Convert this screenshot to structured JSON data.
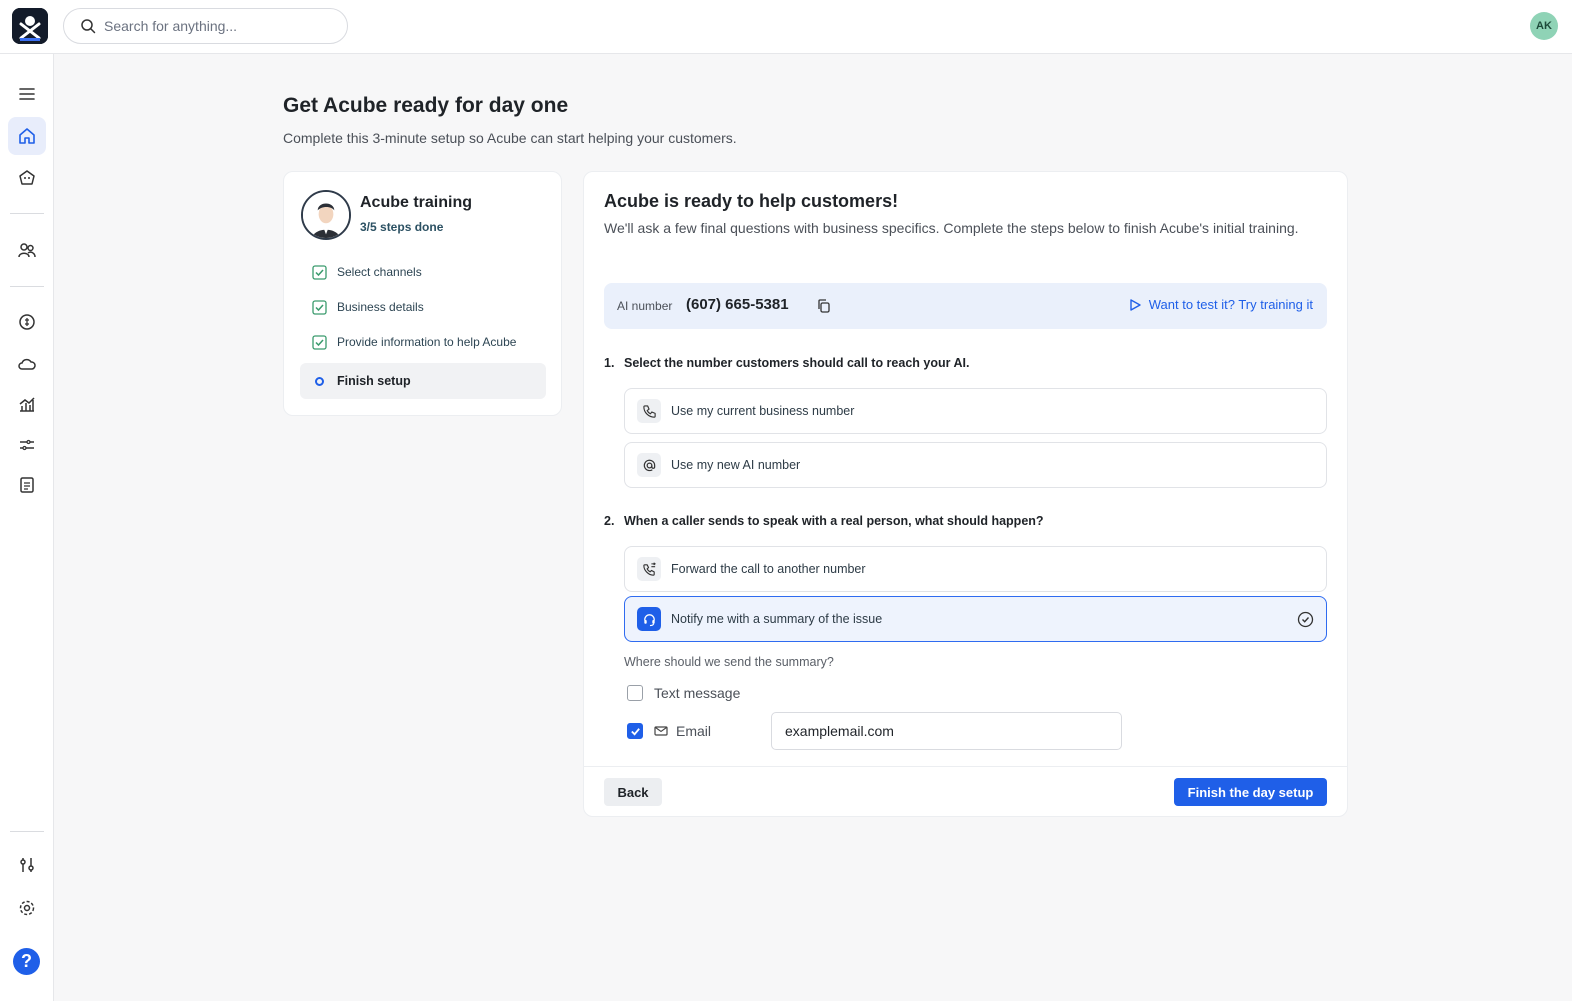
{
  "search": {
    "placeholder": "Search for anything..."
  },
  "user": {
    "initials": "AK"
  },
  "colors": {
    "accent": "#1f5fe8",
    "success": "#3a9b6d"
  },
  "page": {
    "title": "Get Acube ready for day one",
    "subtitle": "Complete this 3-minute setup so Acube can start helping your customers."
  },
  "training": {
    "title": "Acube training",
    "progress": "3/5 steps done",
    "steps": [
      {
        "label": "Select channels",
        "status": "done"
      },
      {
        "label": "Business details",
        "status": "done"
      },
      {
        "label": "Provide information to help Acube",
        "status": "done"
      },
      {
        "label": "Finish setup",
        "status": "current"
      }
    ]
  },
  "main": {
    "title": "Acube is ready to help customers!",
    "description": "We'll ask a few final questions with business specifics. Complete the steps below to finish Acube's initial training.",
    "ai_number_label": "AI number",
    "ai_number": "(607) 665-5381",
    "test_link": "Want to test it? Try training it",
    "q1": {
      "num": "1.",
      "text": "Select the number customers should call to reach your AI.",
      "options": [
        {
          "label": "Use my current business number",
          "icon": "phone-icon"
        },
        {
          "label": "Use my new AI number",
          "icon": "at-sign-icon"
        }
      ]
    },
    "q2": {
      "num": "2.",
      "text": "When a caller sends to speak with a real person, what should happen?",
      "options": [
        {
          "label": "Forward the call to another number",
          "icon": "phone-forward-icon"
        },
        {
          "label": "Notify me with a summary of the issue",
          "icon": "headset-icon",
          "selected": true
        }
      ]
    },
    "summary_question": "Where should we send the summary?",
    "channels": {
      "text_label": "Text message",
      "text_checked": false,
      "email_label": "Email",
      "email_checked": true,
      "email_value": "examplemail.com"
    },
    "back_label": "Back",
    "finish_label": "Finish the day setup"
  }
}
